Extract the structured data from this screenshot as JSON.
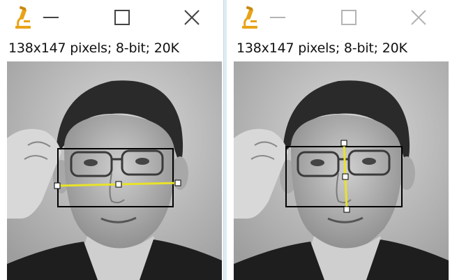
{
  "windows": [
    {
      "info_text": "138x147 pixels; 8-bit; 20K",
      "active": true,
      "selection_tool": "horizontal-line"
    },
    {
      "info_text": "138x147 pixels; 8-bit; 20K",
      "active": false,
      "selection_tool": "vertical-line"
    }
  ],
  "colors": {
    "roi_box": "#000000",
    "line_roi": "#e8e22a",
    "icon_amber": "#e8a317",
    "title_controls_active": "#444444",
    "title_controls_inactive": "#b4b4b4"
  },
  "icons": {
    "app": "microscope-icon",
    "minimize": "minimize-icon",
    "maximize": "maximize-icon",
    "close": "close-icon"
  }
}
